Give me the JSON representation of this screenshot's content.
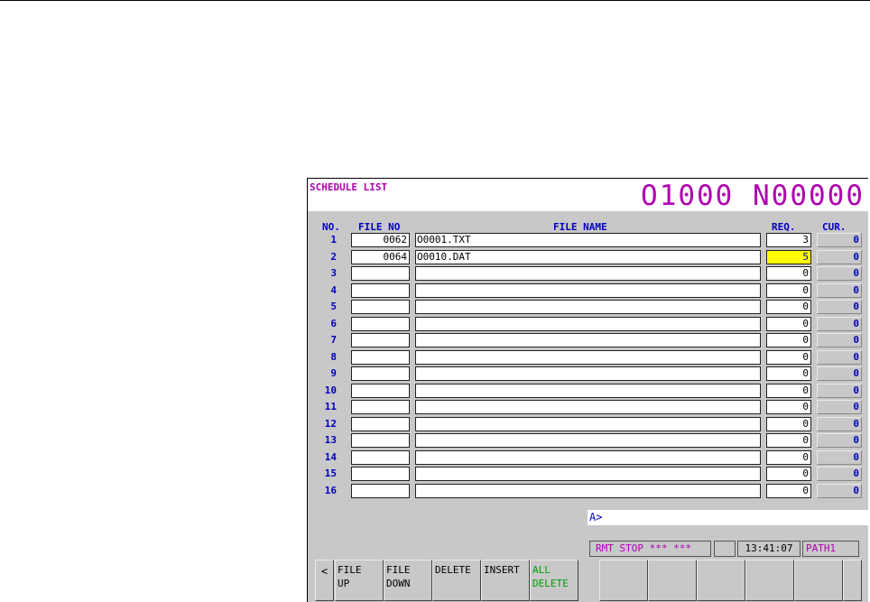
{
  "screen": {
    "title": "SCHEDULE LIST",
    "program": "O1000 N00000"
  },
  "columns": {
    "no": "NO.",
    "file_no": "FILE NO",
    "file_name": "FILE NAME",
    "req": "REQ.",
    "cur": "CUR."
  },
  "rows": [
    {
      "no": "1",
      "file_no": "0062",
      "file_name": "O0001.TXT",
      "req": "3",
      "cur": "0"
    },
    {
      "no": "2",
      "file_no": "0064",
      "file_name": "O0010.DAT",
      "req": "5",
      "cur": "0",
      "highlighted": true
    },
    {
      "no": "3",
      "file_no": "",
      "file_name": "",
      "req": "0",
      "cur": "0"
    },
    {
      "no": "4",
      "file_no": "",
      "file_name": "",
      "req": "0",
      "cur": "0"
    },
    {
      "no": "5",
      "file_no": "",
      "file_name": "",
      "req": "0",
      "cur": "0"
    },
    {
      "no": "6",
      "file_no": "",
      "file_name": "",
      "req": "0",
      "cur": "0"
    },
    {
      "no": "7",
      "file_no": "",
      "file_name": "",
      "req": "0",
      "cur": "0"
    },
    {
      "no": "8",
      "file_no": "",
      "file_name": "",
      "req": "0",
      "cur": "0"
    },
    {
      "no": "9",
      "file_no": "",
      "file_name": "",
      "req": "0",
      "cur": "0"
    },
    {
      "no": "10",
      "file_no": "",
      "file_name": "",
      "req": "0",
      "cur": "0"
    },
    {
      "no": "11",
      "file_no": "",
      "file_name": "",
      "req": "0",
      "cur": "0"
    },
    {
      "no": "12",
      "file_no": "",
      "file_name": "",
      "req": "0",
      "cur": "0"
    },
    {
      "no": "13",
      "file_no": "",
      "file_name": "",
      "req": "0",
      "cur": "0"
    },
    {
      "no": "14",
      "file_no": "",
      "file_name": "",
      "req": "0",
      "cur": "0"
    },
    {
      "no": "15",
      "file_no": "",
      "file_name": "",
      "req": "0",
      "cur": "0"
    },
    {
      "no": "16",
      "file_no": "",
      "file_name": "",
      "req": "0",
      "cur": "0"
    }
  ],
  "input_prompt": "A>",
  "status": {
    "mode": "RMT  STOP *** ***",
    "time": "13:41:07",
    "path": "PATH1"
  },
  "softkeys": {
    "prev": "<",
    "file_up": [
      "FILE",
      "UP"
    ],
    "file_down": [
      "FILE",
      "DOWN"
    ],
    "delete": "DELETE",
    "insert": "INSERT",
    "all_delete": [
      "ALL",
      "DELETE"
    ]
  },
  "colors": {
    "accent": "#b000b0",
    "label": "#0000c0",
    "highlight": "#ffff00",
    "panel": "#c8c8c8"
  }
}
